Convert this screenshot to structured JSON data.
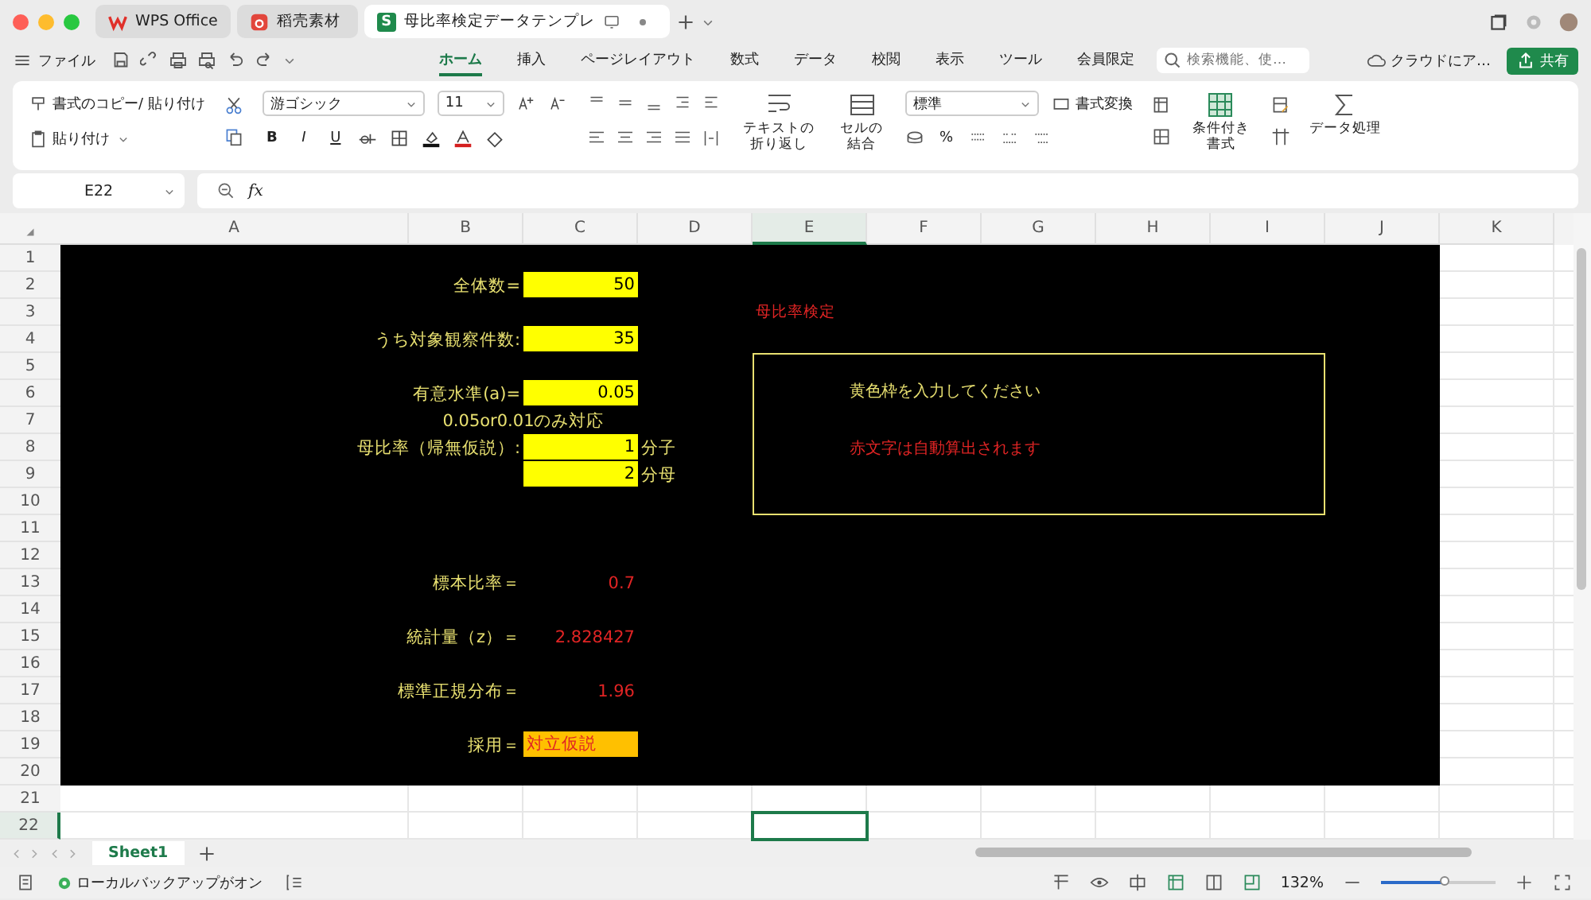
{
  "window": {
    "tabs": [
      {
        "label": "WPS Office",
        "kind": "wps",
        "selected": false
      },
      {
        "label": "稻壳素材",
        "kind": "docer",
        "selected": false
      },
      {
        "label": "母比率検定データテンプレ",
        "kind": "sheet",
        "icon_text": "S",
        "selected": true
      }
    ]
  },
  "menu": {
    "file": "ファイル",
    "tabs": [
      {
        "label": "ホーム",
        "selected": true
      },
      {
        "label": "挿入",
        "selected": false
      },
      {
        "label": "ページレイアウト",
        "selected": false
      },
      {
        "label": "数式",
        "selected": false
      },
      {
        "label": "データ",
        "selected": false
      },
      {
        "label": "校閲",
        "selected": false
      },
      {
        "label": "表示",
        "selected": false
      },
      {
        "label": "ツール",
        "selected": false
      },
      {
        "label": "会員限定",
        "selected": false
      }
    ],
    "search": {
      "placeholder": "検索機能、使…"
    },
    "cloud": "クラウドにア…",
    "share": "共有"
  },
  "ribbon": {
    "format_painter": "書式のコピー/ 貼り付け",
    "paste": "貼り付け",
    "font": "游ゴシック",
    "font_size": "11",
    "bold": "B",
    "italic": "I",
    "underline": "U",
    "wrap": "テキストの折り返し",
    "merge": "セルの結合",
    "number_format": "標準",
    "convert": "書式変換",
    "percent": "%",
    "conditional": "条件付き書式",
    "data_processing": "データ処理"
  },
  "formula_bar": {
    "name_box": "E22",
    "fx": "fx"
  },
  "sheet": {
    "columns": [
      {
        "label": "A",
        "selected": false
      },
      {
        "label": "B",
        "selected": false
      },
      {
        "label": "C",
        "selected": false
      },
      {
        "label": "D",
        "selected": false
      },
      {
        "label": "E",
        "selected": true
      },
      {
        "label": "F",
        "selected": false
      },
      {
        "label": "G",
        "selected": false
      },
      {
        "label": "H",
        "selected": false
      },
      {
        "label": "I",
        "selected": false
      },
      {
        "label": "J",
        "selected": false
      },
      {
        "label": "K",
        "selected": false
      }
    ],
    "rows": [
      {
        "label": "1",
        "selected": false
      },
      {
        "label": "2",
        "selected": false,
        "cells": [
          {
            "text": "全体数=",
            "kind": "label"
          },
          {
            "text": "50",
            "kind": "input"
          }
        ]
      },
      {
        "label": "3",
        "selected": false,
        "cells": [
          {
            "text": "母比率検定",
            "kind": "note"
          }
        ]
      },
      {
        "label": "4",
        "selected": false,
        "cells": [
          {
            "text": "うち対象観察件数:",
            "kind": "label"
          },
          {
            "text": "35",
            "kind": "input"
          }
        ]
      },
      {
        "label": "5",
        "selected": false
      },
      {
        "label": "6",
        "selected": false,
        "cells": [
          {
            "text": "有意水準(a)=",
            "kind": "label"
          },
          {
            "text": "0.05",
            "kind": "input"
          }
        ]
      },
      {
        "label": "7",
        "selected": false,
        "cells": [
          {
            "text": "0.05or0.01のみ対応",
            "kind": "caption"
          }
        ]
      },
      {
        "label": "8",
        "selected": false,
        "cells": [
          {
            "text": "母比率（帰無仮説）:",
            "kind": "label"
          },
          {
            "text": "1",
            "kind": "input"
          },
          {
            "text": "分子",
            "kind": "unit"
          }
        ]
      },
      {
        "label": "9",
        "selected": false,
        "cells": [
          {
            "text": "2",
            "kind": "input"
          },
          {
            "text": "分母",
            "kind": "unit"
          }
        ]
      },
      {
        "label": "10",
        "selected": false
      },
      {
        "label": "11",
        "selected": false
      },
      {
        "label": "12",
        "selected": false
      },
      {
        "label": "13",
        "selected": false,
        "cells": [
          {
            "text": "標本比率＝",
            "kind": "label"
          },
          {
            "text": "0.7",
            "kind": "output"
          }
        ]
      },
      {
        "label": "14",
        "selected": false
      },
      {
        "label": "15",
        "selected": false,
        "cells": [
          {
            "text": "統計量（z）＝",
            "kind": "label"
          },
          {
            "text": "2.828427",
            "kind": "output"
          }
        ]
      },
      {
        "label": "16",
        "selected": false
      },
      {
        "label": "17",
        "selected": false,
        "cells": [
          {
            "text": "標準正規分布＝",
            "kind": "label"
          },
          {
            "text": "1.96",
            "kind": "output"
          }
        ]
      },
      {
        "label": "18",
        "selected": false
      },
      {
        "label": "19",
        "selected": false,
        "cells": [
          {
            "text": "採用＝",
            "kind": "label"
          },
          {
            "text": "対立仮説",
            "kind": "result"
          }
        ]
      },
      {
        "label": "20",
        "selected": false
      },
      {
        "label": "21",
        "selected": false
      },
      {
        "label": "22",
        "selected": true
      }
    ],
    "note_box": {
      "lines": [
        {
          "text": "黄色枠を入力してください",
          "kind": "instruction"
        },
        {
          "text": "赤文字は自動算出されます",
          "kind": "warning"
        }
      ]
    }
  },
  "sheet_tabs": [
    {
      "label": "Sheet1",
      "selected": true
    }
  ],
  "status_bar": {
    "backup": "ローカルバックアップがオン",
    "zoom": "132%",
    "zoom_slider": {
      "level": 0.55
    }
  }
}
